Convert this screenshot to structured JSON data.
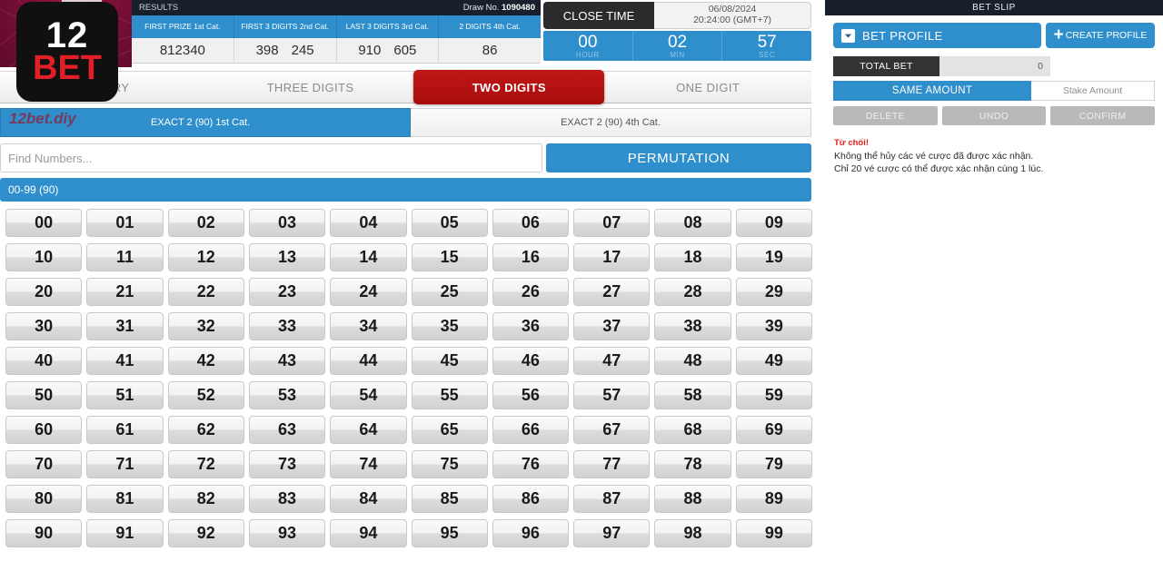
{
  "brand": {
    "logo_line1": "12",
    "logo_line2": "BET",
    "watermark": "12bet.diy"
  },
  "results": {
    "title": "RESULTS",
    "draw_label": "Draw No.",
    "draw_no": "1090480",
    "columns": [
      "FIRST PRIZE 1st Cat.",
      "FIRST 3 DIGITS 2nd Cat.",
      "LAST 3 DIGITS 3rd Cat.",
      "2 DIGITS 4th Cat."
    ],
    "values": [
      [
        "812340"
      ],
      [
        "398",
        "245"
      ],
      [
        "910",
        "605"
      ],
      [
        "86"
      ]
    ]
  },
  "close_time": {
    "label": "CLOSE TIME",
    "date": "06/08/2024",
    "time": "20:24:00 (GMT+7)",
    "countdown": [
      {
        "value": "00",
        "unit": "HOUR"
      },
      {
        "value": "02",
        "unit": "MIN"
      },
      {
        "value": "57",
        "unit": "SEC"
      }
    ]
  },
  "tabs": [
    {
      "label": "TEGORY",
      "active": false
    },
    {
      "label": "THREE DIGITS",
      "active": false
    },
    {
      "label": "TWO DIGITS",
      "active": true
    },
    {
      "label": "ONE DIGIT",
      "active": false
    }
  ],
  "subtabs": [
    {
      "label": "EXACT 2 (90) 1st Cat.",
      "active": true
    },
    {
      "label": "EXACT 2 (90) 4th Cat.",
      "active": false
    }
  ],
  "search": {
    "value": "",
    "placeholder": "Find Numbers..."
  },
  "permutation_label": "PERMUTATION",
  "range_bar": "00-99 (90)",
  "numbers": [
    "00",
    "01",
    "02",
    "03",
    "04",
    "05",
    "06",
    "07",
    "08",
    "09",
    "10",
    "11",
    "12",
    "13",
    "14",
    "15",
    "16",
    "17",
    "18",
    "19",
    "20",
    "21",
    "22",
    "23",
    "24",
    "25",
    "26",
    "27",
    "28",
    "29",
    "30",
    "31",
    "32",
    "33",
    "34",
    "35",
    "36",
    "37",
    "38",
    "39",
    "40",
    "41",
    "42",
    "43",
    "44",
    "45",
    "46",
    "47",
    "48",
    "49",
    "50",
    "51",
    "52",
    "53",
    "54",
    "55",
    "56",
    "57",
    "58",
    "59",
    "60",
    "61",
    "62",
    "63",
    "64",
    "65",
    "66",
    "67",
    "68",
    "69",
    "70",
    "71",
    "72",
    "73",
    "74",
    "75",
    "76",
    "77",
    "78",
    "79",
    "80",
    "81",
    "82",
    "83",
    "84",
    "85",
    "86",
    "87",
    "88",
    "89",
    "90",
    "91",
    "92",
    "93",
    "94",
    "95",
    "96",
    "97",
    "98",
    "99"
  ],
  "bet_slip": {
    "title": "BET SLIP",
    "bet_profile_label": "BET PROFILE",
    "create_profile_label": "CREATE PROFILE",
    "total_bet_label": "TOTAL BET",
    "total_bet_value": "0",
    "same_amount_label": "SAME AMOUNT",
    "stake_amount_placeholder": "Stake Amount",
    "stake_amount_value": "",
    "actions": [
      "DELETE",
      "UNDO",
      "CONFIRM"
    ],
    "message": {
      "title": "Từ chối!",
      "line1": "Không thể hủy các vé cược đã được xác nhận.",
      "line2": "Chỉ 20 vé cược có thể được xác nhận cùng 1 lúc."
    }
  },
  "colors": {
    "accent_blue": "#2f8fcc",
    "active_red": "#b31212",
    "dark_header": "#17202b",
    "logo_red": "#e01f26",
    "warning_red": "#e02020"
  }
}
